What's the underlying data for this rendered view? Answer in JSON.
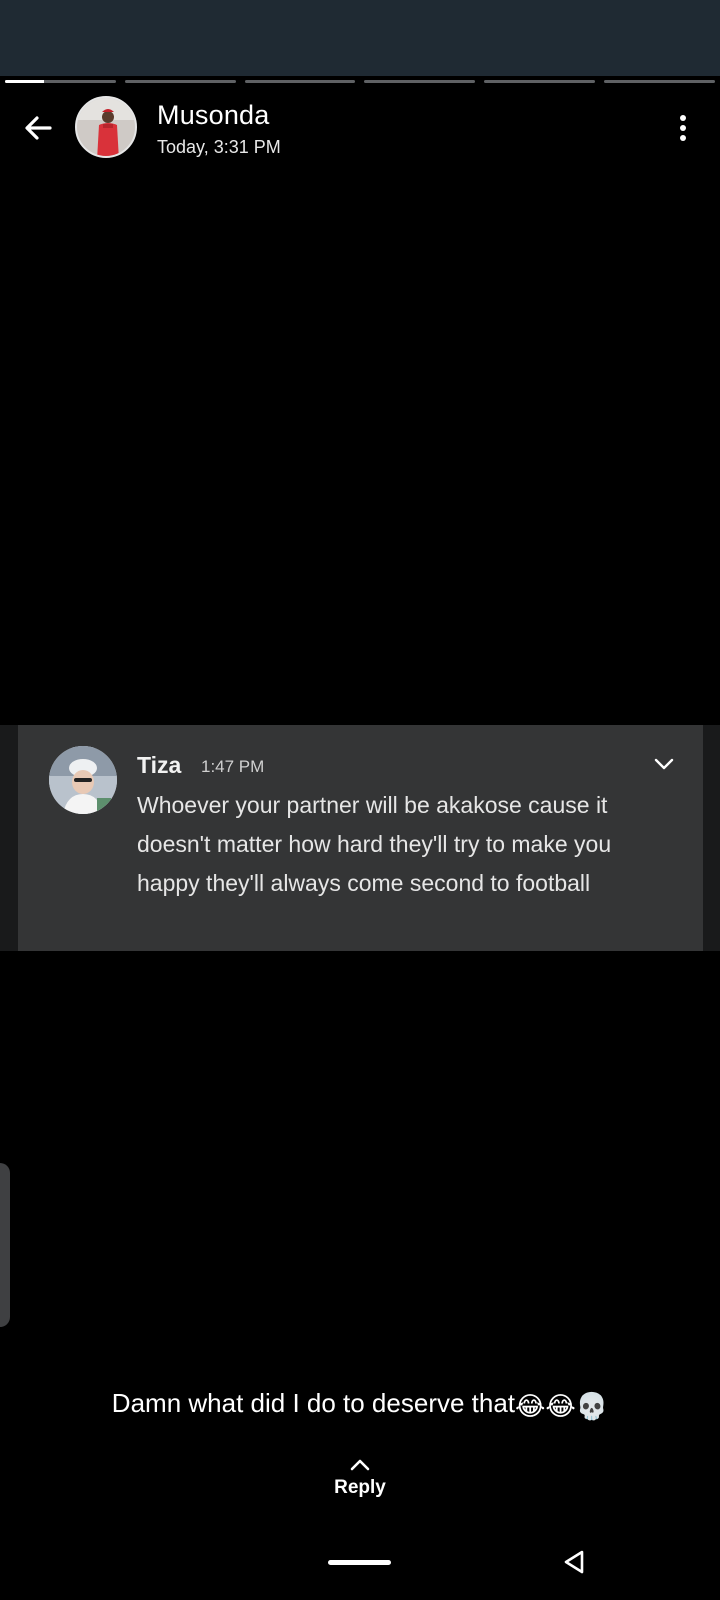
{
  "header": {
    "contact_name": "Musonda",
    "post_time": "Today, 3:31 PM",
    "back_icon": "arrow-left-icon",
    "menu_icon": "more-vertical-icon"
  },
  "progress": {
    "segments": 6,
    "current_index": 0,
    "current_fill": 0.35
  },
  "quoted_message": {
    "sender": "Tiza",
    "time": "1:47 PM",
    "text": "Whoever your partner will be akakose cause it doesn't matter how hard they'll try to make you happy they'll always come second to football",
    "expand_icon": "chevron-down-icon"
  },
  "caption": {
    "text": "Damn what did I do to deserve that",
    "emojis": [
      "😂",
      "😂",
      "💀"
    ]
  },
  "reply": {
    "label": "Reply",
    "icon": "chevron-up-icon"
  },
  "colors": {
    "background": "#000000",
    "status_bar": "#1f2a33",
    "card": "#343536",
    "progress_track": "#5f6164"
  }
}
